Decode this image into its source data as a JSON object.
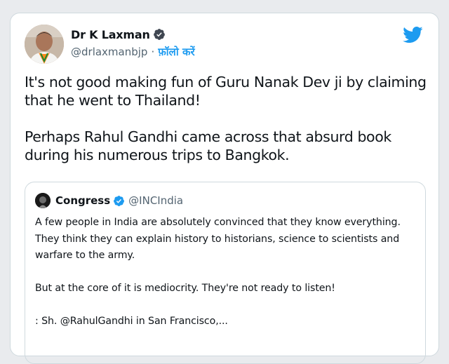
{
  "author": {
    "name": "Dr K Laxman",
    "handle": "@drlaxmanbjp",
    "separator": "·",
    "follow_label": "फ़ॉलो करें",
    "avatar_icon": "profile-photo",
    "verified_icon": "verified-badge-icon"
  },
  "platform": {
    "logo_icon": "twitter-bird-icon",
    "brand_color": "#1d9bf0"
  },
  "tweet": {
    "paragraph1": "It's not good making fun of Guru Nanak Dev ji by claiming that he went to Thailand!",
    "paragraph2": "Perhaps Rahul Gandhi came across that absurd book during his numerous trips to Bangkok."
  },
  "quoted_tweet": {
    "name": "Congress",
    "handle": "@INCIndia",
    "paragraph1": "A few people in India are absolutely convinced that they know everything. They think they can explain history to historians, science to scientists and warfare to the army.",
    "paragraph2": "But at the core of it is mediocrity. They're not ready to listen!",
    "paragraph3": ": Sh. @RahulGandhi in San Francisco,..."
  }
}
